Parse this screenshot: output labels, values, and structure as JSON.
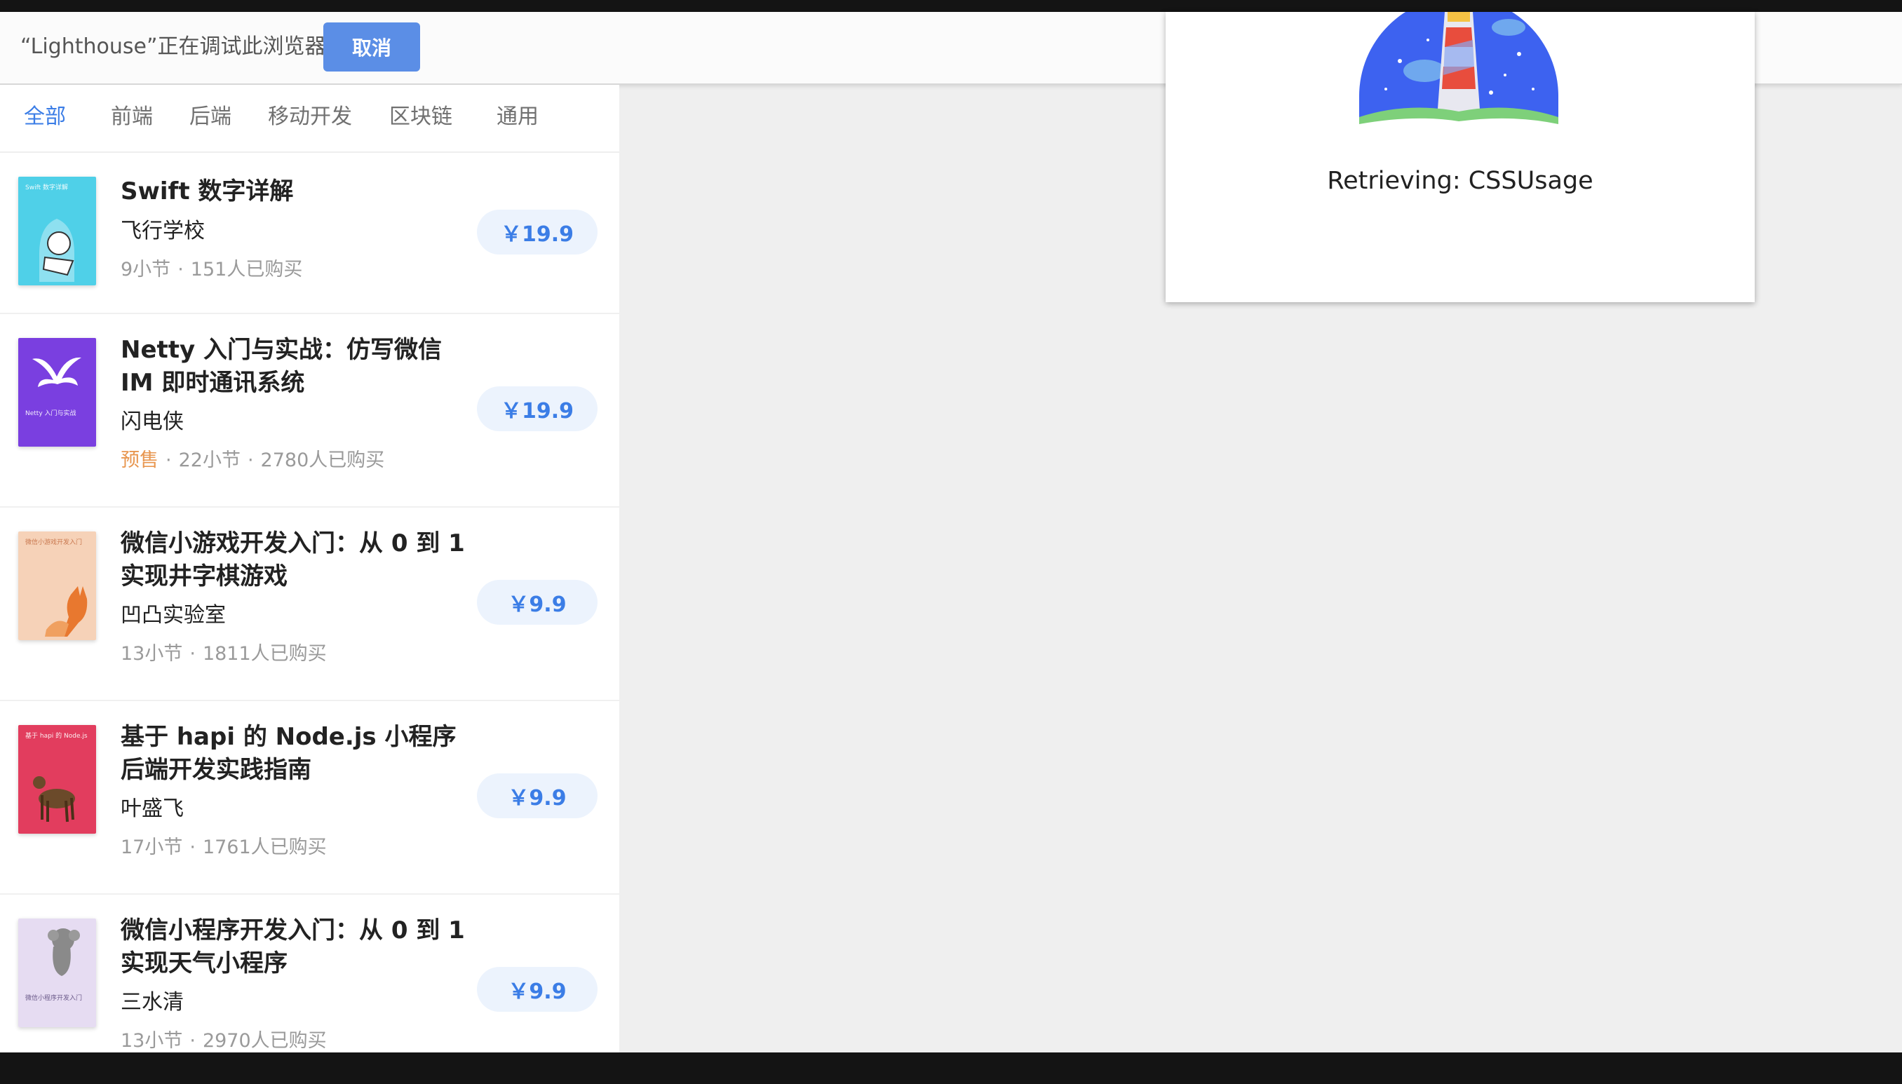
{
  "infobar": {
    "message": "“Lighthouse”正在调试此浏览器",
    "cancel_label": "取消"
  },
  "tabs": [
    {
      "label": "全部",
      "active": true
    },
    {
      "label": "前端",
      "active": false
    },
    {
      "label": "后端",
      "active": false
    },
    {
      "label": "移动开发",
      "active": false
    },
    {
      "label": "区块链",
      "active": false
    },
    {
      "label": "通用",
      "active": false
    }
  ],
  "books": [
    {
      "title": "Swift 数字详解",
      "author": "飞行学校",
      "presale": "",
      "sections": "9小节",
      "buyers": "151人已购买",
      "price": "￥19.9",
      "cover_color": "#4fd0e8",
      "cover_label": "Swift 数字详解"
    },
    {
      "title": "Netty 入门与实战：仿写微信 IM 即时通讯系统",
      "author": "闪电侠",
      "presale": "预售",
      "sections": "22小节",
      "buyers": "2780人已购买",
      "price": "￥19.9",
      "cover_color": "#7a3fe0",
      "cover_label": "Netty 入门与实战"
    },
    {
      "title": "微信小游戏开发入门：从 0 到 1 实现井字棋游戏",
      "author": "凹凸实验室",
      "presale": "",
      "sections": "13小节",
      "buyers": "1811人已购买",
      "price": "￥9.9",
      "cover_color": "#f6d2b8",
      "cover_label": "微信小游戏开发入门"
    },
    {
      "title": "基于 hapi 的 Node.js 小程序后端开发实践指南",
      "author": "叶盛飞",
      "presale": "",
      "sections": "17小节",
      "buyers": "1761人已购买",
      "price": "￥9.9",
      "cover_color": "#e23d5e",
      "cover_label": "基于 hapi 的 Node.js"
    },
    {
      "title": "微信小程序开发入门：从 0 到 1 实现天气小程序",
      "author": "三水清",
      "presale": "",
      "sections": "13小节",
      "buyers": "2970人已购买",
      "price": "￥9.9",
      "cover_color": "#e6dcf2",
      "cover_label": "微信小程序开发入门"
    }
  ],
  "dialog": {
    "status": "Retrieving: CSSUsage"
  },
  "colors": {
    "accent": "#3b7de6",
    "presale": "#e8964f",
    "lighthouse_sky": "#3d62f0"
  }
}
